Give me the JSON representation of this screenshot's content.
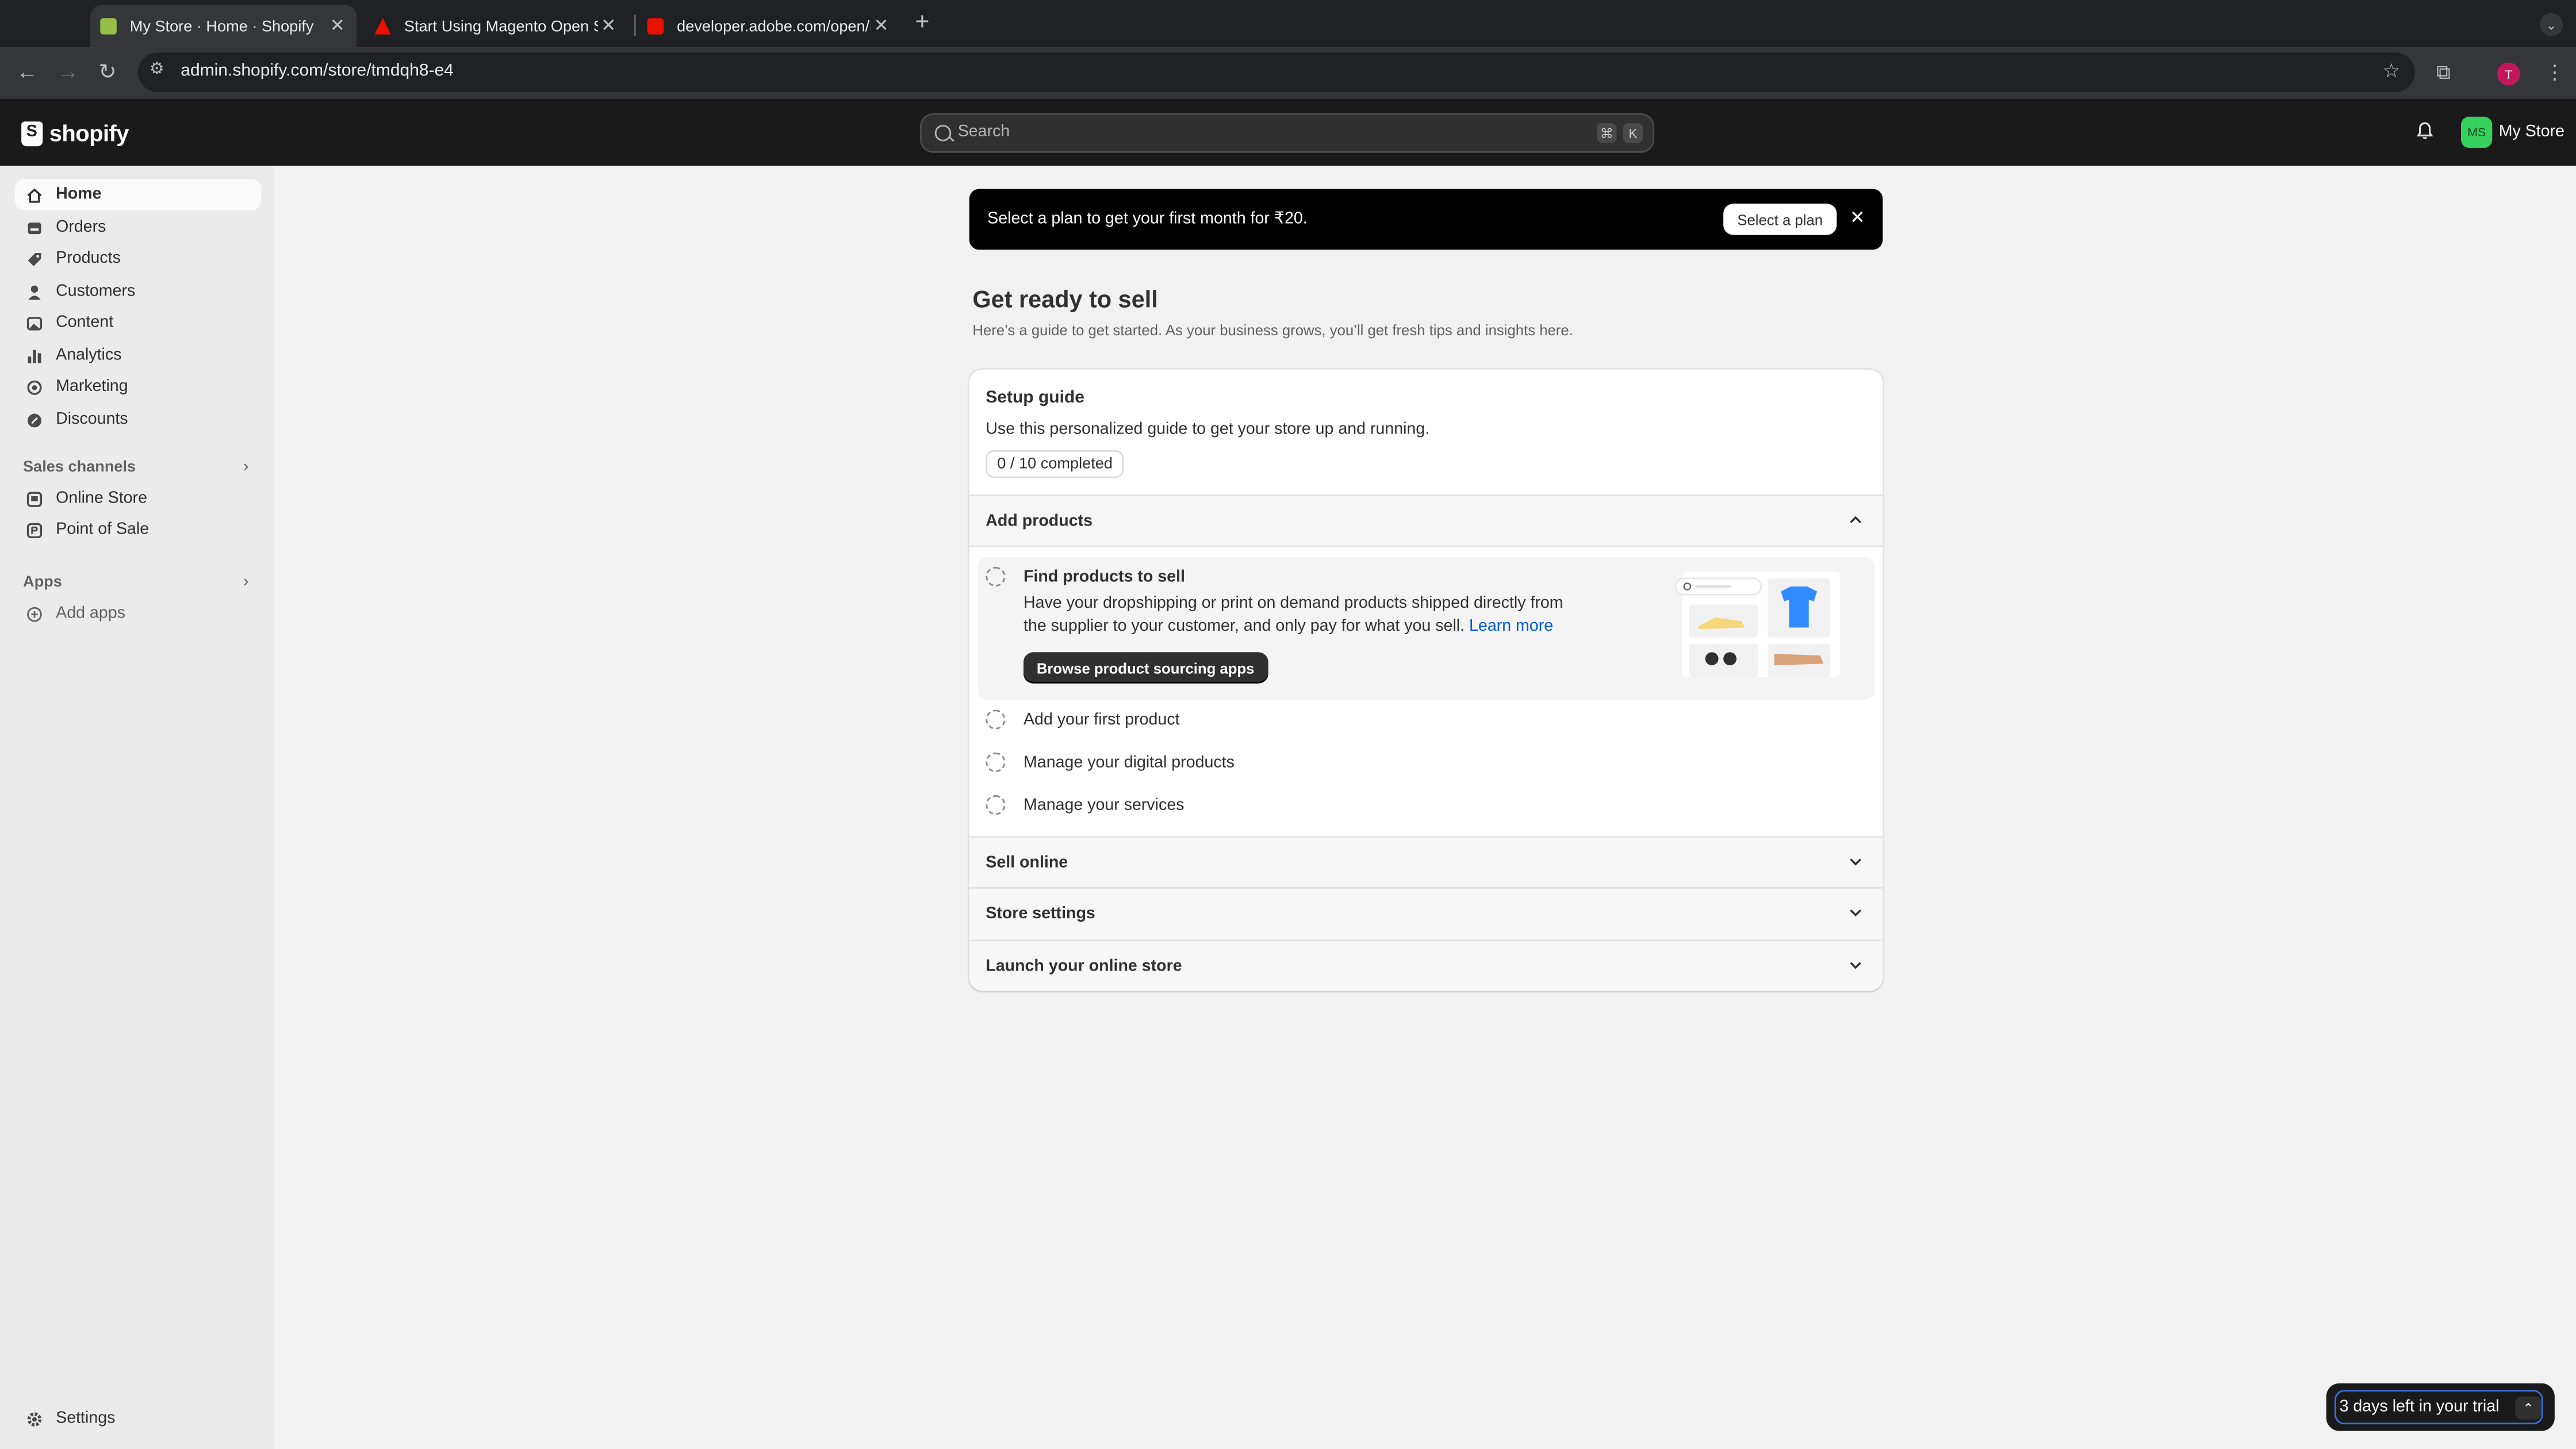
{
  "browser": {
    "tabs": [
      {
        "title": "My Store · Home · Shopify"
      },
      {
        "title": "Start Using Magento Open Sc"
      },
      {
        "title": "developer.adobe.com/open/n"
      }
    ],
    "url": "admin.shopify.com/store/tmdqh8-e4",
    "profile_initial": "T"
  },
  "topbar": {
    "logo": "shopify",
    "search_placeholder": "Search",
    "shortcut_keys": [
      "⌘",
      "K"
    ],
    "store_initials": "MS",
    "store_name": "My Store",
    "avatar_color": "#36d15c"
  },
  "sidebar": {
    "items": [
      {
        "label": "Home",
        "icon": "home-icon",
        "active": true
      },
      {
        "label": "Orders",
        "icon": "orders-icon"
      },
      {
        "label": "Products",
        "icon": "tag-icon"
      },
      {
        "label": "Customers",
        "icon": "person-icon"
      },
      {
        "label": "Content",
        "icon": "image-icon"
      },
      {
        "label": "Analytics",
        "icon": "bar-chart-icon"
      },
      {
        "label": "Marketing",
        "icon": "target-icon"
      },
      {
        "label": "Discounts",
        "icon": "discount-icon"
      }
    ],
    "sales_channels_heading": "Sales channels",
    "sales_channels": [
      {
        "label": "Online Store",
        "icon": "storefront-icon"
      },
      {
        "label": "Point of Sale",
        "icon": "pos-icon"
      }
    ],
    "apps_heading": "Apps",
    "add_apps": "Add apps",
    "settings": "Settings"
  },
  "banner": {
    "text": "Select a plan to get your first month for ₹20.",
    "button": "Select a plan"
  },
  "page": {
    "title": "Get ready to sell",
    "subtitle": "Here’s a guide to get started. As your business grows, you’ll get fresh tips and insights here."
  },
  "setup_guide": {
    "title": "Setup guide",
    "description": "Use this personalized guide to get your store up and running.",
    "progress": "0 / 10 completed",
    "sections": {
      "add_products": "Add products",
      "sell_online": "Sell online",
      "store_settings": "Store settings",
      "launch": "Launch your online store"
    },
    "highlight": {
      "title": "Find products to sell",
      "body": "Have your dropshipping or print on demand products shipped directly from the supplier to your customer, and only pay for what you sell.",
      "link": "Learn more",
      "button": "Browse product sourcing apps"
    },
    "tasks": [
      "Add your first product",
      "Manage your digital products",
      "Manage your services"
    ]
  },
  "trial": {
    "text": "3 days left in your trial"
  }
}
